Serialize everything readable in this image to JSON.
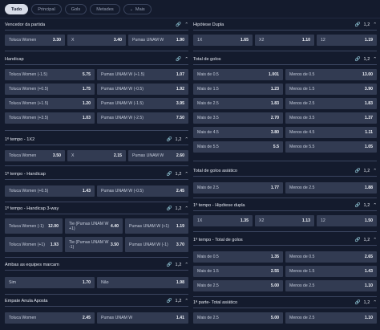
{
  "tabs": [
    {
      "label": "Tudo",
      "active": true
    },
    {
      "label": "Principal",
      "active": false
    },
    {
      "label": "Gols",
      "active": false
    },
    {
      "label": "Metades",
      "active": false
    },
    {
      "label": "Mais",
      "active": false
    }
  ],
  "icons": {
    "link": "link-icon",
    "chevron": "chevron-down-icon"
  },
  "markets": {
    "vencedor": {
      "title": "Vencedor da partida",
      "rows": [
        [
          [
            "Toluca Women",
            "3.30"
          ],
          [
            "X",
            "3.40"
          ],
          [
            "Pumas UNAM W",
            "1.90"
          ]
        ]
      ]
    },
    "handicap": {
      "title": "Handicap",
      "rows": [
        [
          [
            "Toluca Women (-1.5)",
            "5.75"
          ],
          [
            "Pumas UNAM W (+1.5)",
            "1.07"
          ]
        ],
        [
          [
            "Toluca Women (+0.5)",
            "1.75"
          ],
          [
            "Pumas UNAM W (-0.5)",
            "1.92"
          ]
        ],
        [
          [
            "Toluca Women (+1.5)",
            "1.20"
          ],
          [
            "Pumas UNAM W (-1.5)",
            "3.95"
          ]
        ],
        [
          [
            "Toluca Women (+3.5)",
            "1.03"
          ],
          [
            "Pumas UNAM W (-2.5)",
            "7.50"
          ]
        ]
      ]
    },
    "tempo1x2": {
      "title": "1º tempo - 1X2",
      "count": "1,2",
      "rows": [
        [
          [
            "Toluca Women",
            "3.50"
          ],
          [
            "X",
            "2.15"
          ],
          [
            "Pumas UNAM W",
            "2.60"
          ]
        ]
      ]
    },
    "tempoHandicap": {
      "title": "1º tempo - Handicap",
      "count": "1,2",
      "rows": [
        [
          [
            "Toluca Women (+0.5)",
            "1.43"
          ],
          [
            "Pumas UNAM W (-0.5)",
            "2.45"
          ]
        ]
      ]
    },
    "handicap3": {
      "title": "1º tempo - Handicap 3-way",
      "count": "1,2",
      "rows": [
        [
          [
            "Toluca Women (-1)",
            "12.00"
          ],
          [
            "Tie (Pumas UNAM W +1)",
            "4.40"
          ],
          [
            "Pumas UNAM W (+1)",
            "1.19"
          ]
        ],
        [
          [
            "Toluca Women (+1)",
            "1.93"
          ],
          [
            "Tie (Pumas UNAM W -1)",
            "3.50"
          ],
          [
            "Pumas UNAM W (-1)",
            "3.70"
          ]
        ]
      ]
    },
    "ambas": {
      "title": "Ambas as equipes marcam",
      "count": "1,2",
      "rows": [
        [
          [
            "Sim",
            "1.70"
          ],
          [
            "Não",
            "1.98"
          ]
        ]
      ]
    },
    "empate": {
      "title": "Empate Anula Aposta",
      "count": "1,2",
      "rows": [
        [
          [
            "Toluca Women",
            "2.45"
          ],
          [
            "Pumas UNAM W",
            "1.41"
          ]
        ]
      ]
    },
    "hipotese": {
      "title": "Hipótese Dupla",
      "count": "1,2",
      "rows": [
        [
          [
            "1X",
            "1.65"
          ],
          [
            "X2",
            "1.10"
          ],
          [
            "12",
            "1.19"
          ]
        ]
      ]
    },
    "totalGols": {
      "title": "Total de golos",
      "count": "1,2",
      "rows": [
        [
          [
            "Mais de 0.5",
            "1.001"
          ],
          [
            "Menos de 0.5",
            "13.00"
          ]
        ],
        [
          [
            "Mais de 1.5",
            "1.23"
          ],
          [
            "Menos de 1.5",
            "3.90"
          ]
        ],
        [
          [
            "Mais de 2.5",
            "1.83"
          ],
          [
            "Menos de 2.5",
            "1.83"
          ]
        ],
        [
          [
            "Mais de 3.5",
            "2.70"
          ],
          [
            "Menos de 3.5",
            "1.37"
          ]
        ],
        [
          [
            "Mais de 4.5",
            "3.80"
          ],
          [
            "Menos de 4.5",
            "1.11"
          ]
        ],
        [
          [
            "Mais de 5.5",
            "5.5"
          ],
          [
            "Menos de 5.5",
            "1.05"
          ]
        ]
      ]
    },
    "totalAsiatico": {
      "title": "Total de golos asiático",
      "count": "1,2",
      "rows": [
        [
          [
            "Mais de 2.5",
            "1.77"
          ],
          [
            "Menos de 2.5",
            "1.88"
          ]
        ]
      ]
    },
    "hipoteseTempo": {
      "title": "1º tempo - Hipótese dupla",
      "count": "1,2",
      "rows": [
        [
          [
            "1X",
            "1.35"
          ],
          [
            "X2",
            "1.13"
          ],
          [
            "12",
            "1.50"
          ]
        ]
      ]
    },
    "totalTempo": {
      "title": "1º tempo - Total de golos",
      "count": "1,2",
      "rows": [
        [
          [
            "Mais de 0.5",
            "1.35"
          ],
          [
            "Menos de 0.5",
            "2.65"
          ]
        ],
        [
          [
            "Mais de 1.5",
            "2.55"
          ],
          [
            "Menos de 1.5",
            "1.43"
          ]
        ],
        [
          [
            "Mais de 2.5",
            "5.00"
          ],
          [
            "Menos de 2.5",
            "1.10"
          ]
        ]
      ]
    },
    "totalAsiaticoTempo": {
      "title": "1ª parte- Total asiático",
      "count": "1,2",
      "rows": [
        [
          [
            "Mais de 2.5",
            "5.00"
          ],
          [
            "Menos de 2.5",
            "1.10"
          ]
        ]
      ]
    }
  }
}
